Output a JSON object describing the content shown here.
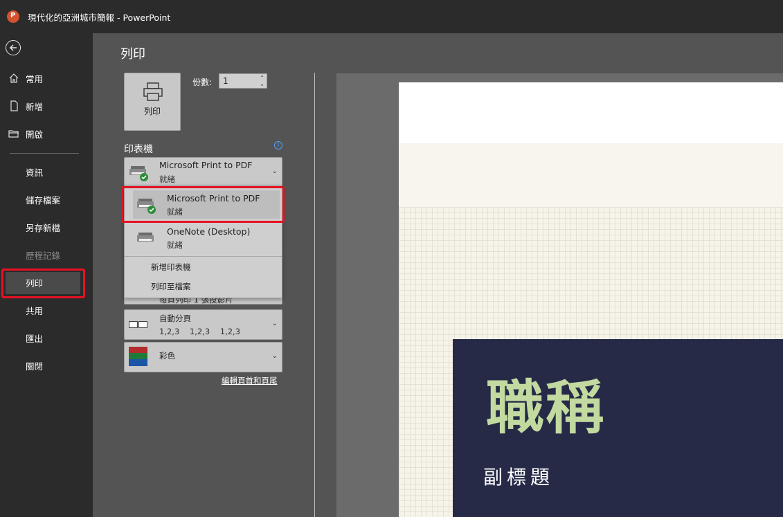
{
  "window": {
    "title": "現代化的亞洲城市簡報 - PowerPoint"
  },
  "nav": {
    "items": [
      {
        "label": "常用"
      },
      {
        "label": "新增"
      },
      {
        "label": "開啟"
      },
      {
        "label": "資訊"
      },
      {
        "label": "儲存檔案"
      },
      {
        "label": "另存新檔"
      },
      {
        "label": "歷程記錄"
      },
      {
        "label": "列印"
      },
      {
        "label": "共用"
      },
      {
        "label": "匯出"
      },
      {
        "label": "關閉"
      }
    ]
  },
  "print": {
    "page_title": "列印",
    "print_button_label": "列印",
    "copies_label": "份數:",
    "copies_value": "1",
    "printer_section_label": "印表機",
    "current_printer": {
      "name": "Microsoft Print to PDF",
      "status": "就緒"
    },
    "printer_menu": {
      "items": [
        {
          "name": "Microsoft Print to PDF",
          "status": "就緒"
        },
        {
          "name": "OneNote (Desktop)",
          "status": "就緒"
        }
      ],
      "actions": [
        "新增印表機",
        "列印至檔案"
      ]
    },
    "layout_partial_label": "每頁列印 1 張投影片",
    "collate": {
      "label": "自動分頁",
      "detail": "1,2,3    1,2,3    1,2,3"
    },
    "color": {
      "label": "彩色"
    },
    "edit_header_footer": "編輯頁首和頁尾"
  },
  "preview": {
    "slide_title": "職稱",
    "slide_subtitle": "副標題",
    "colors": {
      "box": "#262a47",
      "title": "#c2d9a0"
    }
  },
  "colors": {
    "highlight": "#e81123",
    "accent": "#4ea3ff"
  }
}
